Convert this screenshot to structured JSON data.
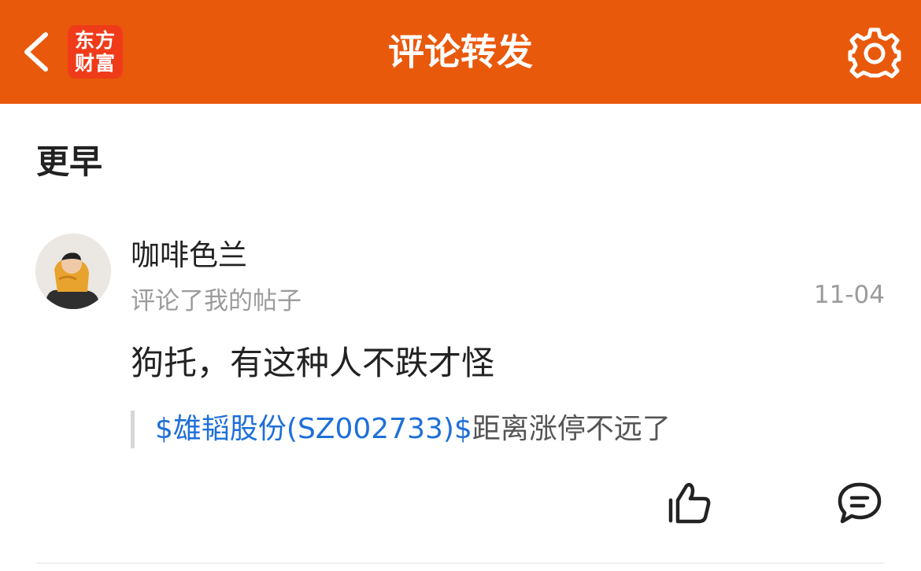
{
  "header": {
    "title": "评论转发",
    "logo_line1": "东方",
    "logo_line2": "财富",
    "back_icon": "chevron-left-icon",
    "settings_icon": "gear-icon",
    "bg_color": "#e9590c"
  },
  "section": {
    "label": "更早"
  },
  "notification": {
    "username": "咖啡色兰",
    "action": "评论了我的帖子",
    "date": "11-04",
    "comment": "狗托，有这种人不跌才怪",
    "quote_stock": "$雄韬股份(SZ002733)$",
    "quote_text": "距离涨停不远了",
    "stock_link_color": "#1e6fd9"
  },
  "actions": {
    "like_icon": "thumbs-up-icon",
    "reply_icon": "comment-bubble-icon"
  }
}
